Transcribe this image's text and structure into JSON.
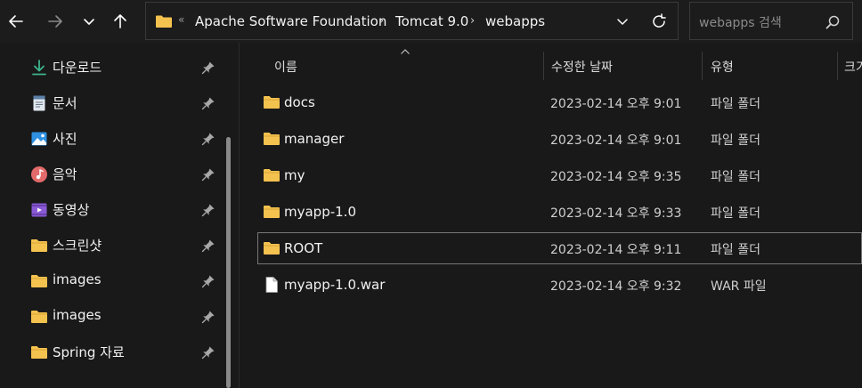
{
  "nav": {
    "back_icon": "arrow-left-icon",
    "forward_icon": "arrow-right-icon",
    "recent_icon": "chevron-down-icon",
    "up_icon": "arrow-up-icon"
  },
  "address": {
    "overflow": "«",
    "crumbs": [
      "Apache Software Foundation",
      "Tomcat 9.0",
      "webapps"
    ],
    "separator": "›"
  },
  "search": {
    "placeholder": "webapps 검색"
  },
  "sidebar": {
    "items": [
      {
        "label": "다운로드",
        "icon": "download-icon"
      },
      {
        "label": "문서",
        "icon": "document-icon"
      },
      {
        "label": "사진",
        "icon": "picture-icon"
      },
      {
        "label": "음악",
        "icon": "music-icon"
      },
      {
        "label": "동영상",
        "icon": "video-icon"
      },
      {
        "label": "스크린샷",
        "icon": "folder-icon"
      },
      {
        "label": "images",
        "icon": "folder-icon"
      },
      {
        "label": "images",
        "icon": "folder-icon"
      },
      {
        "label": "Spring 자료",
        "icon": "folder-icon"
      }
    ]
  },
  "columns": {
    "name": "이름",
    "modified": "수정한 날짜",
    "type": "유형",
    "size": "크기"
  },
  "files": [
    {
      "name": "docs",
      "modified": "2023-02-14 오후 9:01",
      "type": "파일 폴더",
      "icon": "folder-icon"
    },
    {
      "name": "manager",
      "modified": "2023-02-14 오후 9:01",
      "type": "파일 폴더",
      "icon": "folder-icon"
    },
    {
      "name": "my",
      "modified": "2023-02-14 오후 9:35",
      "type": "파일 폴더",
      "icon": "folder-icon"
    },
    {
      "name": "myapp-1.0",
      "modified": "2023-02-14 오후 9:33",
      "type": "파일 폴더",
      "icon": "folder-icon"
    },
    {
      "name": "ROOT",
      "modified": "2023-02-14 오후 9:11",
      "type": "파일 폴더",
      "icon": "folder-icon"
    },
    {
      "name": "myapp-1.0.war",
      "modified": "2023-02-14 오후 9:32",
      "type": "WAR 파일",
      "icon": "file-icon"
    }
  ],
  "colors": {
    "background": "#191919",
    "folder": "#f4c24f",
    "accent_download": "#3cb48c"
  }
}
